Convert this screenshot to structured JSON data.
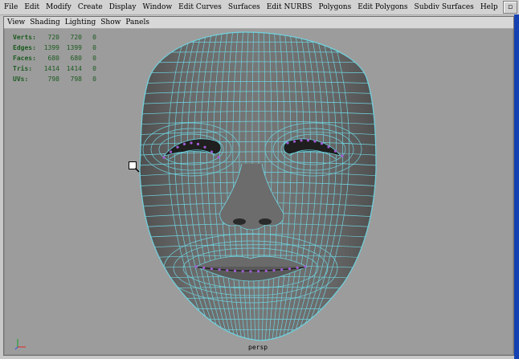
{
  "menubar": {
    "items": [
      "File",
      "Edit",
      "Modify",
      "Create",
      "Display",
      "Window",
      "Edit Curves",
      "Surfaces",
      "Edit NURBS",
      "Polygons",
      "Edit Polygons",
      "Subdiv Surfaces",
      "Help"
    ]
  },
  "panel_menu": {
    "items": [
      "View",
      "Shading",
      "Lighting",
      "Show",
      "Panels"
    ]
  },
  "hud": {
    "rows": [
      {
        "label": "Verts:",
        "values": [
          "720",
          "720",
          "0"
        ]
      },
      {
        "label": "Edges:",
        "values": [
          "1399",
          "1399",
          "0"
        ]
      },
      {
        "label": "Faces:",
        "values": [
          "680",
          "680",
          "0"
        ]
      },
      {
        "label": "Tris:",
        "values": [
          "1414",
          "1414",
          "0"
        ]
      },
      {
        "label": "UVs:",
        "values": [
          "798",
          "798",
          "0"
        ]
      }
    ]
  },
  "viewport": {
    "camera": "persp"
  },
  "icons": {
    "corner": "maximize-icon",
    "axis": "axis-gizmo-icon",
    "cursor": "magnifier-cursor-icon"
  },
  "colors": {
    "mesh_fill": "#5d5d5d",
    "mesh_edge": "#6fd3df",
    "selected_vertex": "#a15cd6",
    "hud_text": "#1b5b1f",
    "viewport_bg": "#9c9c9c",
    "title_accent": "#1542b3"
  }
}
